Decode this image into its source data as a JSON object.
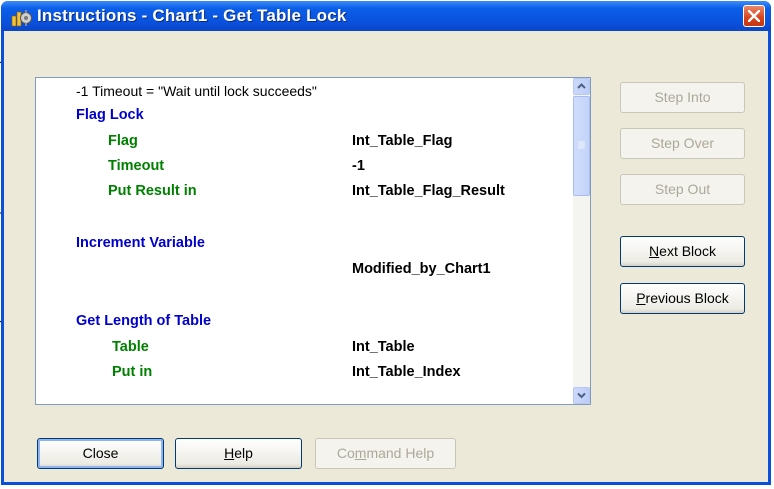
{
  "window": {
    "title": "Instructions - Chart1 - Get Table Lock",
    "icon": "gear-chart-icon",
    "title_bar_color": "#0a52de",
    "close_color": "#d8431a"
  },
  "instructions": {
    "intro": "-1 Timeout = \"Wait until lock succeeds\"",
    "blocks": [
      {
        "header": "Flag Lock",
        "rows": [
          {
            "label": "Flag",
            "value": "Int_Table_Flag"
          },
          {
            "label": "Timeout",
            "value": "-1"
          },
          {
            "label": "Put Result in",
            "value": "Int_Table_Flag_Result"
          }
        ]
      },
      {
        "header": "Increment Variable",
        "rows": [
          {
            "label": "",
            "value": "Modified_by_Chart1"
          }
        ]
      },
      {
        "header": "Get Length of Table",
        "rows": [
          {
            "label": "Table",
            "value": "Int_Table"
          },
          {
            "label": "Put in",
            "value": "Int_Table_Index"
          }
        ]
      }
    ]
  },
  "side_buttons": {
    "step_into": "Step Into",
    "step_over": "Step Over",
    "step_out": "Step Out",
    "next_block_pre": "",
    "next_block_mnemonic": "N",
    "next_block_post": "ext Block",
    "previous_block_pre": "",
    "previous_block_mnemonic": "P",
    "previous_block_post": "revious Block"
  },
  "bottom_buttons": {
    "close": "Close",
    "help_mnemonic": "H",
    "help_post": "elp",
    "command_help_pre": "Co",
    "command_help_mnemonic": "m",
    "command_help_post": "mand Help"
  },
  "colors": {
    "header_blue": "#0000cc",
    "label_green": "#008000",
    "dialog_bg": "#ece9d8"
  }
}
